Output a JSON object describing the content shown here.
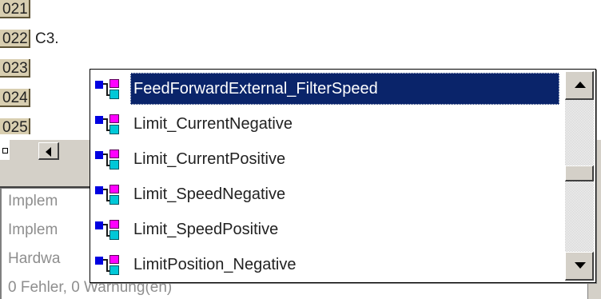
{
  "editor": {
    "lines": [
      {
        "num": "021",
        "text": ""
      },
      {
        "num": "022",
        "text": "C3."
      },
      {
        "num": "023",
        "text": ""
      },
      {
        "num": "024",
        "text": ""
      },
      {
        "num": "025",
        "text": ""
      }
    ]
  },
  "messages": [
    "Implem",
    "Implem",
    "Hardwa",
    "0 Fehler, 0 Warnung(en)"
  ],
  "autocomplete": {
    "selected_index": 0,
    "items": [
      {
        "label": "FeedForwardExternal_FilterSpeed",
        "icon": "symbol-variable-icon"
      },
      {
        "label": "Limit_CurrentNegative",
        "icon": "symbol-variable-icon"
      },
      {
        "label": "Limit_CurrentPositive",
        "icon": "symbol-variable-icon"
      },
      {
        "label": "Limit_SpeedNegative",
        "icon": "symbol-variable-icon"
      },
      {
        "label": "Limit_SpeedPositive",
        "icon": "symbol-variable-icon"
      },
      {
        "label": "LimitPosition_Negative",
        "icon": "symbol-variable-icon"
      }
    ],
    "colors": {
      "selection_bg": "#0a246a",
      "selection_fg": "#ffffff",
      "gutter_bg": "#d8ceb0"
    }
  }
}
